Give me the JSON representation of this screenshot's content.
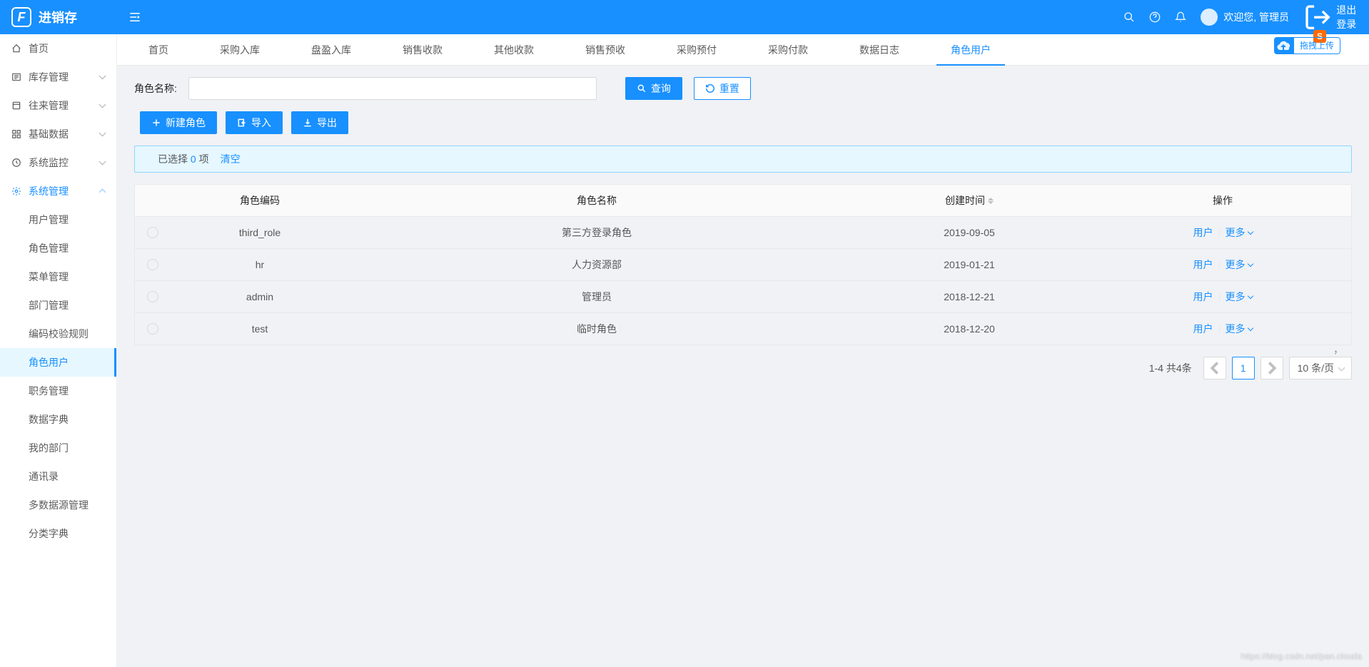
{
  "header": {
    "logo_text": "进销存",
    "welcome": "欢迎您, 管理员",
    "logout": "退出登录",
    "upload_text": "拖拽上传"
  },
  "sidebar": {
    "items": [
      {
        "label": "首页",
        "icon": "home"
      },
      {
        "label": "库存管理",
        "icon": "list",
        "children": true
      },
      {
        "label": "往来管理",
        "icon": "box",
        "children": true
      },
      {
        "label": "基础数据",
        "icon": "grid",
        "children": true
      },
      {
        "label": "系统监控",
        "icon": "dashboard",
        "children": true
      },
      {
        "label": "系统管理",
        "icon": "gear",
        "children": true,
        "expanded": true
      }
    ],
    "sub_items": [
      "用户管理",
      "角色管理",
      "菜单管理",
      "部门管理",
      "编码校验规则",
      "角色用户",
      "职务管理",
      "数据字典",
      "我的部门",
      "通讯录",
      "多数据源管理",
      "分类字典"
    ],
    "active_sub": "角色用户"
  },
  "tabs": [
    "首页",
    "采购入库",
    "盘盈入库",
    "销售收款",
    "其他收款",
    "销售预收",
    "采购预付",
    "采购付款",
    "数据日志",
    "角色用户"
  ],
  "active_tab": "角色用户",
  "search": {
    "label": "角色名称:",
    "query_btn": "查询",
    "reset_btn": "重置"
  },
  "actions": {
    "new_btn": "新建角色",
    "import_btn": "导入",
    "export_btn": "导出"
  },
  "alert": {
    "prefix": "已选择 ",
    "count": "0",
    "suffix": " 项",
    "clear": "清空"
  },
  "table": {
    "headers": {
      "code": "角色编码",
      "name": "角色名称",
      "date": "创建时间",
      "action": "操作"
    },
    "rows": [
      {
        "code": "third_role",
        "name": "第三方登录角色",
        "date": "2019-09-05"
      },
      {
        "code": "hr",
        "name": "人力资源部",
        "date": "2019-01-21"
      },
      {
        "code": "admin",
        "name": "管理员",
        "date": "2018-12-21"
      },
      {
        "code": "test",
        "name": "临时角色",
        "date": "2018-12-20"
      }
    ],
    "action_user": "用户",
    "action_more": "更多"
  },
  "pagination": {
    "info": "1-4 共4条",
    "current": "1",
    "size": "10 条/页"
  },
  "watermark": "https://blog.csdn.net/pan.clouda"
}
